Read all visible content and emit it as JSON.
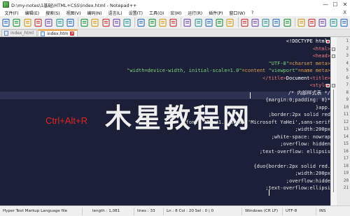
{
  "window": {
    "title": "D:\\my-notes\\1基础\\HTML+CSS\\index.html - Notepad++",
    "minimize": "—",
    "maximize": "☐",
    "close": "✕"
  },
  "menu": {
    "items": [
      "文件(F)",
      "编辑(E)",
      "搜索(S)",
      "视图(V)",
      "编码(N)",
      "语言(L)",
      "设置(T)",
      "工具(O)",
      "宏(M)",
      "运行(R)",
      "插件(P)",
      "窗口(W)",
      "?"
    ],
    "close_x": "X"
  },
  "toolbar": {
    "icons": [
      "new-file-icon",
      "open-file-icon",
      "save-icon",
      "save-all-icon",
      "close-file-icon",
      "close-all-icon",
      "print-icon",
      "cut-icon",
      "copy-icon",
      "paste-icon",
      "undo-icon",
      "redo-icon",
      "find-icon",
      "replace-icon",
      "zoom-in-icon",
      "zoom-out-icon",
      "sync-vertical-icon",
      "sync-horizontal-icon",
      "word-wrap-icon",
      "show-all-chars-icon",
      "indent-guide-icon",
      "lang-icon",
      "doc-map-icon",
      "function-list-icon",
      "folder-workspace-icon",
      "monitor-icon",
      "record-macro-icon",
      "stop-macro-icon",
      "play-macro-icon",
      "run-macro-multiple-icon",
      "save-macro-icon"
    ]
  },
  "tabs": [
    {
      "label": "index_html",
      "active": false
    },
    {
      "label": "index.htm",
      "active": true
    }
  ],
  "editor": {
    "lines": [
      {
        "n": "1",
        "segments": [
          {
            "cls": "c-txt",
            "t": "<!DOCTYPE html"
          },
          {
            "cls": "c-tag",
            "t": ">"
          }
        ]
      },
      {
        "n": "2",
        "segments": [
          {
            "cls": "c-tag",
            "t": "<html>"
          }
        ]
      },
      {
        "n": "3",
        "segments": [
          {
            "cls": "c-tag",
            "t": "<head>"
          }
        ]
      },
      {
        "n": "4",
        "segments": [
          {
            "cls": "c-val",
            "t": "\"UTF-8\""
          },
          {
            "cls": "c-attr",
            "t": "=charset meta>"
          }
        ]
      },
      {
        "n": "5",
        "segments": [
          {
            "cls": "c-val",
            "t": "\"width=device-width, initial-scale=1.0\""
          },
          {
            "cls": "c-attr",
            "t": "=content "
          },
          {
            "cls": "c-val",
            "t": "\"viewport\""
          },
          {
            "cls": "c-attr",
            "t": "=name meta>"
          }
        ]
      },
      {
        "n": "6",
        "segments": [
          {
            "cls": "c-tag",
            "t": "</title>"
          },
          {
            "cls": "c-txt",
            "t": "Document"
          },
          {
            "cls": "c-tag",
            "t": "<title>"
          }
        ]
      },
      {
        "n": "7",
        "segments": [
          {
            "cls": "c-tag",
            "t": "<style>"
          }
        ]
      },
      {
        "n": "8",
        "segments": [
          {
            "cls": "c-prop",
            "t": "/* 内部样式表 */"
          }
        ]
      },
      {
        "n": "9",
        "segments": [
          {
            "cls": "c-prop",
            "t": "{margin:0;padding: 0}*"
          }
        ]
      },
      {
        "n": "10",
        "segments": [
          {
            "cls": "c-prop",
            "t": "}app."
          }
        ]
      },
      {
        "n": "11",
        "segments": [
          {
            "cls": "c-prop",
            "t": ";border:2px solid red"
          }
        ]
      },
      {
        "n": "12",
        "segments": [
          {
            "cls": "c-prop",
            "t": ";font: 12px/1.5 arial,'Microsoft YaHei',sans-serif"
          }
        ]
      },
      {
        "n": "13",
        "segments": [
          {
            "cls": "c-prop",
            "t": ";width:200px"
          }
        ]
      },
      {
        "n": "14",
        "segments": [
          {
            "cls": "c-prop",
            "t": ";white-space: nowrap"
          }
        ]
      },
      {
        "n": "15",
        "segments": [
          {
            "cls": "c-prop",
            "t": ";overflow: hidden"
          }
        ]
      },
      {
        "n": "16",
        "segments": [
          {
            "cls": "c-prop",
            "t": ";text-overflow: ellipsis"
          }
        ]
      },
      {
        "n": "17",
        "segments": [
          {
            "cls": "c-prop",
            "t": ""
          }
        ]
      },
      {
        "n": "18",
        "segments": [
          {
            "cls": "c-prop",
            "t": "{duo{border:2px solid red."
          }
        ]
      },
      {
        "n": "19",
        "segments": [
          {
            "cls": "c-prop",
            "t": ";width:200px"
          }
        ]
      },
      {
        "n": "20",
        "segments": [
          {
            "cls": "c-prop",
            "t": ";overflow:hidde"
          }
        ]
      },
      {
        "n": "21",
        "segments": [
          {
            "cls": "c-prop",
            "t": ";text-overflow:ellipsi"
          }
        ]
      }
    ],
    "overlay_shortcut": "Ctrl+Alt+R",
    "watermark": "木星教程网"
  },
  "status": {
    "language": "Hyper Text Markup Language file",
    "length": "length : 1,081",
    "lines": "lines : 33",
    "position": "Ln : 8    Col : 20    Sel : 0 | 0",
    "eol": "Windows (CR LF)",
    "encoding": "UTF-8",
    "mode": "INS"
  }
}
